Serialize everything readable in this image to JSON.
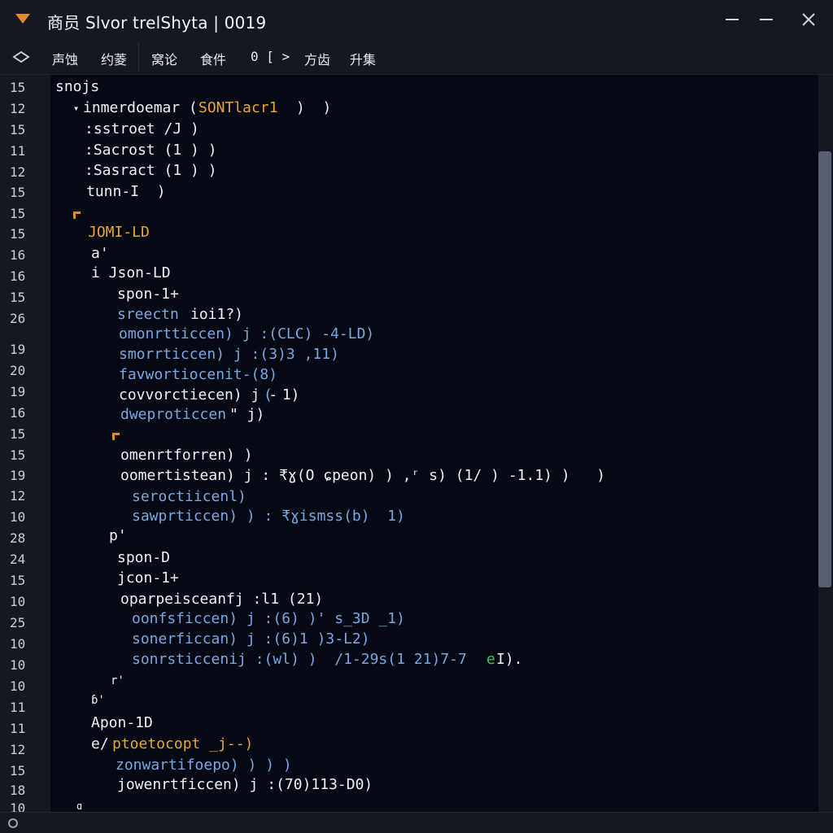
{
  "window": {
    "title": "商员 Slvor trelShyta | 0019"
  },
  "menu": {
    "items": [
      "声蚀",
      "约菱",
      "窝论",
      "食件",
      "0 [ >",
      "方齿",
      "升集"
    ]
  },
  "gutter": {
    "numbers": [
      "15",
      "12",
      "15",
      "11",
      "12",
      "15",
      "15",
      "15",
      "16",
      "16",
      "15",
      "26",
      "19",
      "20",
      "19",
      "16",
      "15",
      "15",
      "19",
      "12",
      "10",
      "28",
      "24",
      "15",
      "10",
      "25",
      "10",
      "10",
      "10",
      "11",
      "11",
      "12",
      "15",
      "18",
      "10"
    ]
  },
  "code": {
    "lines": [
      "snojs",
      "inmerdoemar (",
      "SONTlacr1",
      ")  )",
      ":sstroet /J )",
      ":Sacrost (1 ) )",
      ":Sasract (1 ) )",
      "tunn-I  )",
      "JOMI-LD",
      "a'",
      "i Json-LD",
      "spon-1+",
      "sreectn",
      "ioi1?)",
      "omonrtticcen) j :(CLC) -4-LD)",
      "smorrticcen) j :(3)3 ,11)",
      "favwortiocenit-(8)",
      "covvorctiecen) j -",
      "(",
      " 1)",
      "dweproticcen",
      "\" j)",
      "omenrtforren) )",
      "oomertistean) j : ₹ɣ(O ɕpeon) ) ,ʳ s) (1/ ) -1.1) )   )",
      "seroctiicenl)",
      "sawprticcen) ) : ₹ɣismss(b)  1)",
      "p'",
      "spon-D",
      "jcon-1+",
      "oparpeisceanfj :l1 (21)",
      "oonfsficcen) j :(6) )' s_3D _1)",
      "sonerficcan) j :(6)1 )3-L2)",
      "sonrsticcenij :(wl) )  /1-29s(1 21)7-7",
      "e",
      "I).",
      "r'",
      "ɓ'",
      "Apon-1D",
      "e/",
      "ptoetocopt _j--)",
      "zonwartifoepo) ) ) )",
      "jowenrtficcen) j :(70)113-D0)",
      "ɑ"
    ]
  },
  "colors": {
    "accent_orange": "#e58a20",
    "keyword_yellow": "#e8a632",
    "keyword_blue": "#7aa7e2",
    "accent_green": "#34c759",
    "editor_bg": "#050914",
    "chrome_bg": "#141821"
  },
  "icons": {
    "app": "chevron-down-icon",
    "menu": "eye-icon",
    "minimize": "minimize-icon",
    "maximize": "maximize-icon",
    "close": "close-icon",
    "status": "circle-icon"
  }
}
